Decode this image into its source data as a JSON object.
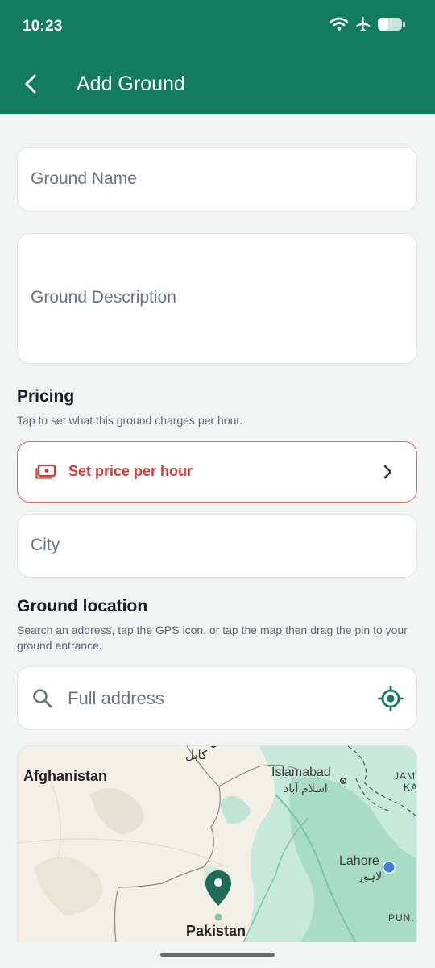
{
  "status_bar": {
    "time": "10:23",
    "icons": [
      "wifi-icon",
      "airplane-icon",
      "battery-icon"
    ]
  },
  "app_bar": {
    "title": "Add Ground",
    "back_icon": "chevron-left-icon"
  },
  "form": {
    "ground_name": {
      "placeholder": "Ground Name",
      "value": ""
    },
    "ground_description": {
      "placeholder": "Ground Description",
      "value": ""
    },
    "pricing": {
      "title": "Pricing",
      "subtitle": "Tap to set what this ground charges per hour.",
      "button_label": "Set price per hour",
      "icon": "money-icon"
    },
    "city": {
      "placeholder": "City",
      "value": ""
    },
    "location": {
      "title": "Ground location",
      "subtitle": "Search an address, tap the GPS icon, or tap the map then drag the pin to your ground entrance.",
      "address_placeholder": "Full address"
    }
  },
  "map": {
    "labels": {
      "afghanistan": "Afghanistan",
      "kabul": "کابل",
      "islamabad": "Islamabad",
      "islamabad_urdu": "اسلام آباد",
      "jammu": "JAM",
      "kashmir": "KA",
      "lahore": "Lahore",
      "lahore_urdu": "لاہور",
      "punjab": "PUN.",
      "pakistan": "Pakistan"
    }
  },
  "colors": {
    "primary": "#127c5c",
    "danger": "#cf3d35",
    "background": "#f2f4f3"
  }
}
